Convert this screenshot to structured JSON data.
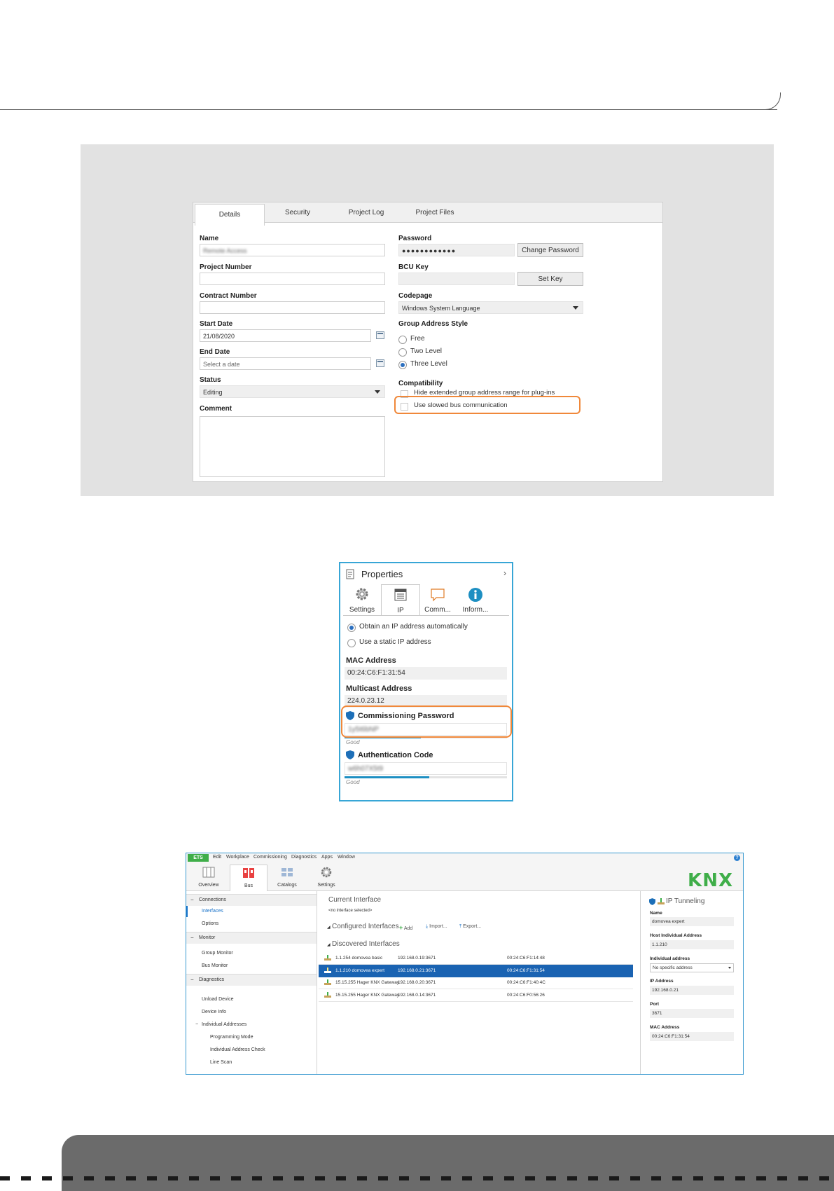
{
  "project_dialog": {
    "tabs": [
      "Details",
      "Security",
      "Project Log",
      "Project Files"
    ],
    "fields": {
      "name_label": "Name",
      "name_value": "Remote Access",
      "project_number_label": "Project Number",
      "project_number_value": "",
      "contract_number_label": "Contract Number",
      "contract_number_value": "",
      "start_date_label": "Start Date",
      "start_date_value": "21/08/2020",
      "end_date_label": "End Date",
      "end_date_placeholder": "Select a date",
      "status_label": "Status",
      "status_value": "Editing",
      "comment_label": "Comment",
      "comment_value": "",
      "password_label": "Password",
      "password_value": "●●●●●●●●●●●●",
      "change_password_button": "Change Password",
      "bcu_key_label": "BCU Key",
      "bcu_key_value": "",
      "set_key_button": "Set Key",
      "codepage_label": "Codepage",
      "codepage_value": "Windows System Language",
      "group_address_style_label": "Group Address Style",
      "group_address_options": [
        "Free",
        "Two Level",
        "Three Level"
      ],
      "group_address_selected": "Three Level",
      "compatibility_label": "Compatibility",
      "compat_hide_extended": "Hide extended group address range for plug-ins",
      "compat_slowed_bus": "Use slowed bus communication"
    },
    "highlight_color": "#f0883a"
  },
  "properties_panel": {
    "title": "Properties",
    "tabs": [
      "Settings",
      "IP",
      "Comm...",
      "Inform..."
    ],
    "active_tab": "IP",
    "ip_auto": "Obtain an IP address automatically",
    "ip_static": "Use a static IP address",
    "ip_mode_selected": "Obtain an IP address automatically",
    "mac_label": "MAC Address",
    "mac_value": "00:24:C6:F1:31:54",
    "multicast_label": "Multicast Address",
    "multicast_value": "224.0.23.12",
    "commissioning_label": "Commissioning Password",
    "commissioning_value": "1y5t6bNP",
    "commissioning_strength": "Good",
    "commissioning_strength_fraction": 0.47,
    "auth_label": "Authentication Code",
    "auth_value": "w6h07X5t9",
    "auth_strength": "Good",
    "auth_strength_fraction": 0.52,
    "accent_color": "#38a6d6"
  },
  "ets_window": {
    "badge": "ETS",
    "menu": [
      "Edit",
      "Workplace",
      "Commissioning",
      "Diagnostics",
      "Apps",
      "Window"
    ],
    "help": "?",
    "ribbon": [
      "Overview",
      "Bus",
      "Catalogs",
      "Settings"
    ],
    "active_ribbon": "Bus",
    "logo": "KNX",
    "nav": {
      "connections": "Connections",
      "interfaces": "Interfaces",
      "options": "Options",
      "monitor": "Monitor",
      "group_monitor": "Group Monitor",
      "bus_monitor": "Bus Monitor",
      "diagnostics": "Diagnostics",
      "unload_device": "Unload Device",
      "device_info": "Device Info",
      "individual_addresses": "Individual Addresses",
      "programming_mode": "Programming Mode",
      "individual_address_check": "Individual Address Check",
      "line_scan": "Line Scan"
    },
    "current_interface_title": "Current Interface",
    "no_interface": "<no interface selected>",
    "configured_title": "Configured Interfaces",
    "add": "Add",
    "import": "Import...",
    "export": "Export...",
    "discovered_title": "Discovered Interfaces",
    "interfaces": [
      {
        "name": "1.1.254 domovea basic",
        "ip": "192.168.0.19:3671",
        "mac": "00:24:C6:F1:14:48",
        "selected": false
      },
      {
        "name": "1.1.210 domovea expert",
        "ip": "192.168.0.21:3671",
        "mac": "00:24:C6:F1:31:54",
        "selected": true
      },
      {
        "name": "15.15.255 Hager KNX Gateway",
        "ip": "192.168.0.20:3671",
        "mac": "00:24:C6:F1:40:4C",
        "selected": false
      },
      {
        "name": "15.15.255 Hager KNX Gateway",
        "ip": "192.168.0.14:3671",
        "mac": "00:24:C6:F0:56:26",
        "selected": false
      }
    ],
    "details": {
      "title": "IP Tunneling",
      "name_label": "Name",
      "name_value": "domovea expert",
      "host_label": "Host Individual Address",
      "host_value": "1.1.210",
      "individual_label": "Individual address",
      "individual_value": "No specific address",
      "ip_label": "IP Address",
      "ip_value": "192.168.0.21",
      "port_label": "Port",
      "port_value": "3671",
      "mac_label": "MAC Address",
      "mac_value": "00:24:C6:F1:31:54"
    },
    "accent_green": "#3fae49",
    "selection_blue": "#1a63b2"
  }
}
